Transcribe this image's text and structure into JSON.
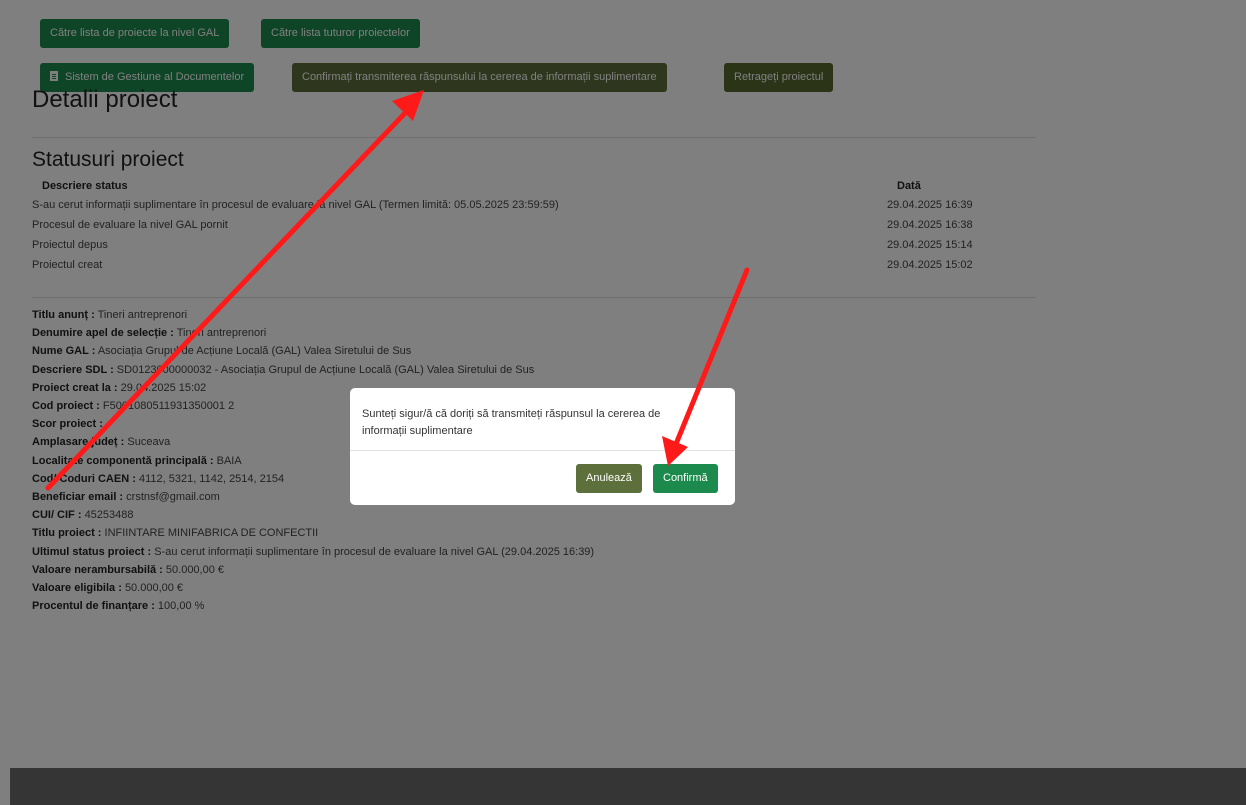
{
  "nav": {
    "gal_list": "Către lista de proiecte la nivel GAL",
    "all_projects": "Către lista tuturor proiectelor",
    "doc_system": "Sistem de Gestiune al Documentelor",
    "confirm_response": "Confirmați transmiterea răspunsului la cererea de informații suplimentare",
    "withdraw": "Retrageți proiectul"
  },
  "page": {
    "title": "Detalii proiect",
    "statuses_title": "Statusuri proiect",
    "col_description": "Descriere status",
    "col_date": "Dată"
  },
  "statuses": [
    {
      "description": "S-au cerut informații suplimentare în procesul de evaluare la nivel GAL (Termen limită: 05.05.2025 23:59:59)",
      "date": "29.04.2025 16:39"
    },
    {
      "description": "Procesul de evaluare la nivel GAL pornit",
      "date": "29.04.2025 16:38"
    },
    {
      "description": "Proiectul depus",
      "date": "29.04.2025 15:14"
    },
    {
      "description": "Proiectul creat",
      "date": "29.04.2025 15:02"
    }
  ],
  "details": [
    {
      "label": "Titlu anunț :",
      "value": "Tineri antreprenori"
    },
    {
      "label": "Denumire apel de selecție :",
      "value": "Tineri antreprenori"
    },
    {
      "label": "Nume GAL :",
      "value": "Asociația Grupul de Acțiune Locală (GAL) Valea Siretului de Sus"
    },
    {
      "label": "Descriere SDL :",
      "value": "SD0123000000032 - Asociația Grupul de Acțiune Locală (GAL) Valea Siretului de Sus"
    },
    {
      "label": "Proiect creat la :",
      "value": "29.04.2025 15:02"
    },
    {
      "label": "Cod proiect :",
      "value": "F5001080511931350001 2"
    },
    {
      "label": "Scor proiect :",
      "value": "-"
    },
    {
      "label": "Amplasare județ :",
      "value": "Suceava"
    },
    {
      "label": "Localitate componentă principală :",
      "value": "BAIA"
    },
    {
      "label": "Cod/ Coduri CAEN :",
      "value": "4112, 5321, 1142, 2514, 2154"
    },
    {
      "label": "Beneficiar email :",
      "value": "crstnsf@gmail.com"
    },
    {
      "label": "CUI/ CIF :",
      "value": "45253488"
    },
    {
      "label": "Titlu proiect :",
      "value": "INFIINTARE MINIFABRICA DE CONFECTII"
    },
    {
      "label": "Ultimul status proiect :",
      "value": "S-au cerut informații suplimentare în procesul de evaluare la nivel GAL (29.04.2025 16:39)"
    },
    {
      "label": "Valoare nerambursabilă :",
      "value": "50.000,00 €"
    },
    {
      "label": "Valoare eligibila :",
      "value": "50.000,00 €"
    },
    {
      "label": "Procentul de finanțare :",
      "value": "100,00 %"
    }
  ],
  "modal": {
    "message": "Sunteți sigur/ă că doriți să transmiteți răspunsul la cererea de informații suplimentare",
    "cancel": "Anulează",
    "confirm": "Confirmă"
  },
  "colors": {
    "primary_green": "#1c8a4c",
    "olive": "#5d6f3a",
    "annotation_red": "#ff1a1a"
  }
}
